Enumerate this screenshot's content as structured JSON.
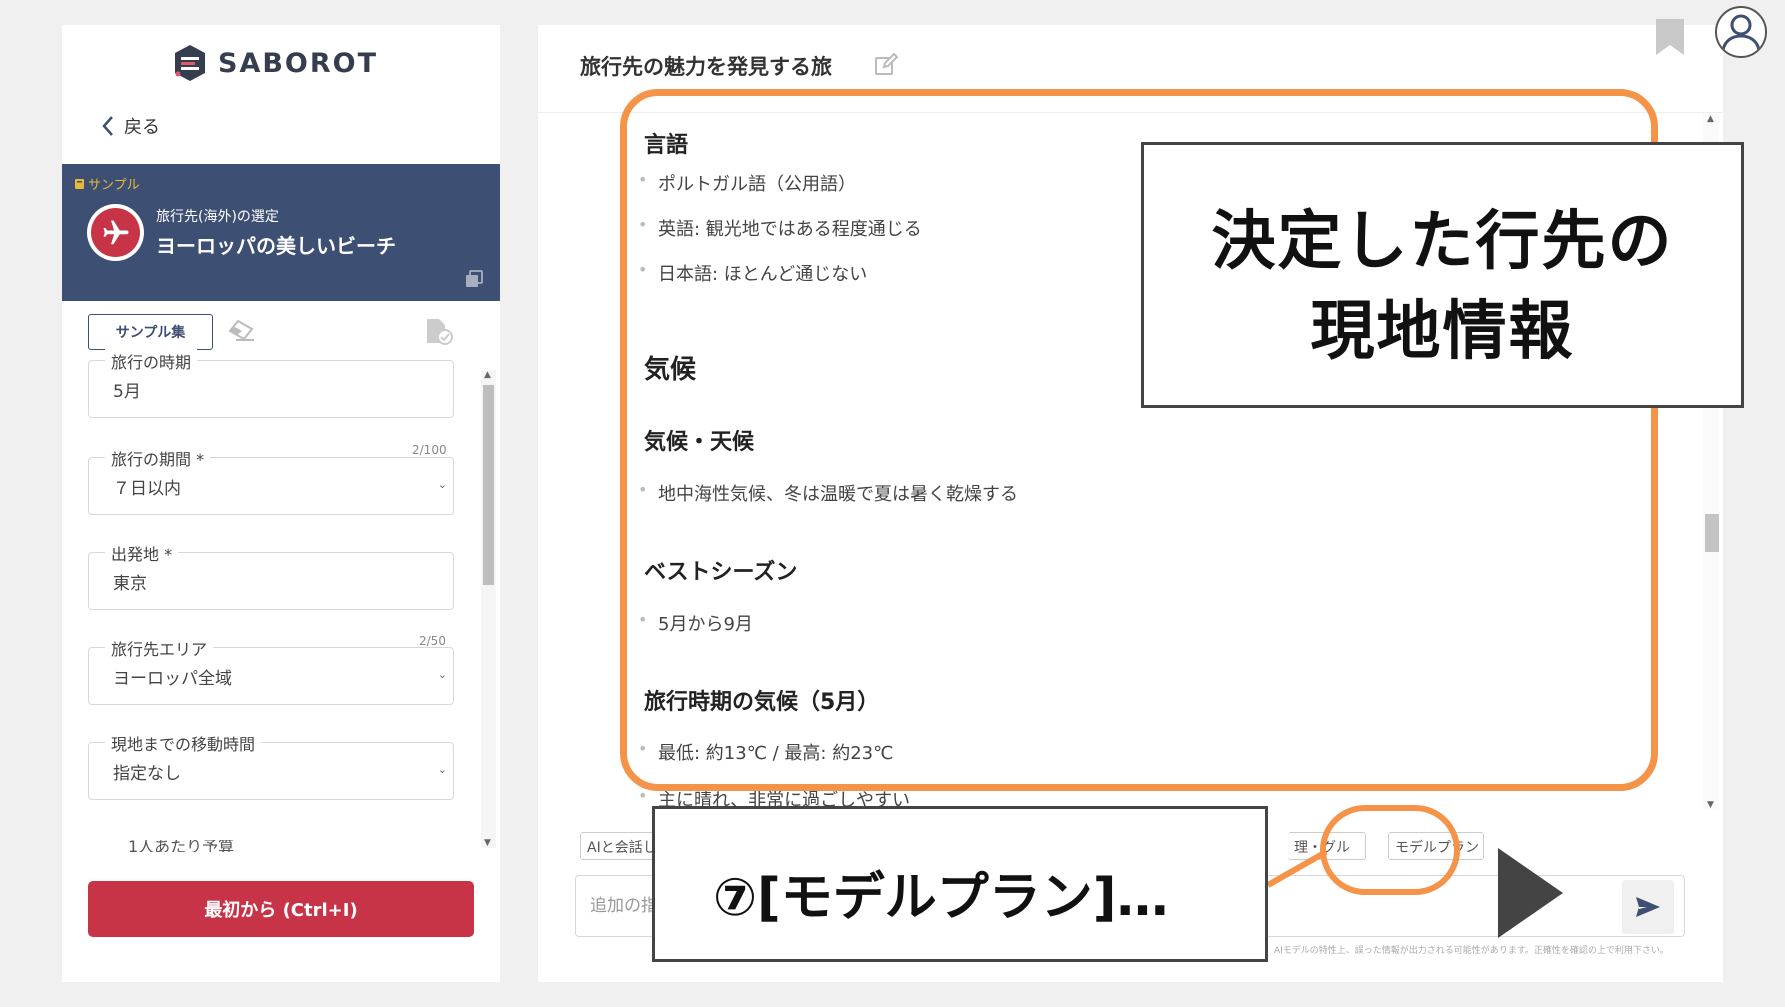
{
  "left_panel": {
    "logo_text": "SABOROT",
    "back_label": "戻る",
    "sample_card": {
      "tag": "サンプル",
      "subtitle": "旅行先(海外)の選定",
      "title": "ヨーロッパの美しいビーチ"
    },
    "sample_list_button": "サンプル集",
    "fields": [
      {
        "label": "旅行の時期",
        "value": "5月",
        "counter": "2/100"
      },
      {
        "label": "旅行の期間 *",
        "value": "７日以内"
      },
      {
        "label": "出発地 *",
        "value": "東京",
        "counter": "2/50"
      },
      {
        "label": "旅行先エリア",
        "value": "ヨーロッパ全域"
      },
      {
        "label": "現地までの移動時間",
        "value": "指定なし"
      }
    ],
    "cut_label": "1人あたり予算",
    "reset_button": "最初から (Ctrl+I)"
  },
  "chat": {
    "title": "旅行先の魅力を発見する旅",
    "sections": {
      "language_heading": "言語",
      "language_items": [
        "ポルトガル語（公用語）",
        "英語: 観光地ではある程度通じる",
        "日本語: ほとんど通じない"
      ],
      "climate_heading": "気候",
      "climate_weather_heading": "気候・天候",
      "climate_weather_items": [
        "地中海性気候、冬は温暖で夏は暑く乾燥する"
      ],
      "best_season_heading": "ベストシーズン",
      "best_season_items": [
        "5月から9月"
      ],
      "trip_climate_heading": "旅行時期の気候（5月）",
      "trip_climate_items": [
        "最低: 約13℃ / 最高: 約23℃",
        "主に晴れ、非常に過ごしやすい"
      ]
    },
    "chips": {
      "ai_talk": "AIと会話し",
      "group": "理・グル",
      "model_plan": "モデルプラン"
    },
    "input_placeholder": "追加の指示",
    "disclaimer": "AIモデルの特性上、誤った情報が出力される可能性があります。正確性を確認の上で利用下さい。"
  },
  "annotations": {
    "callout_line1": "決定した行先の",
    "callout_line2": "現地情報",
    "step_text": "⑦[モデルプラン]…"
  },
  "colors": {
    "navy": "#3d4f72",
    "red": "#c83447",
    "highlight_orange": "#f59449"
  }
}
